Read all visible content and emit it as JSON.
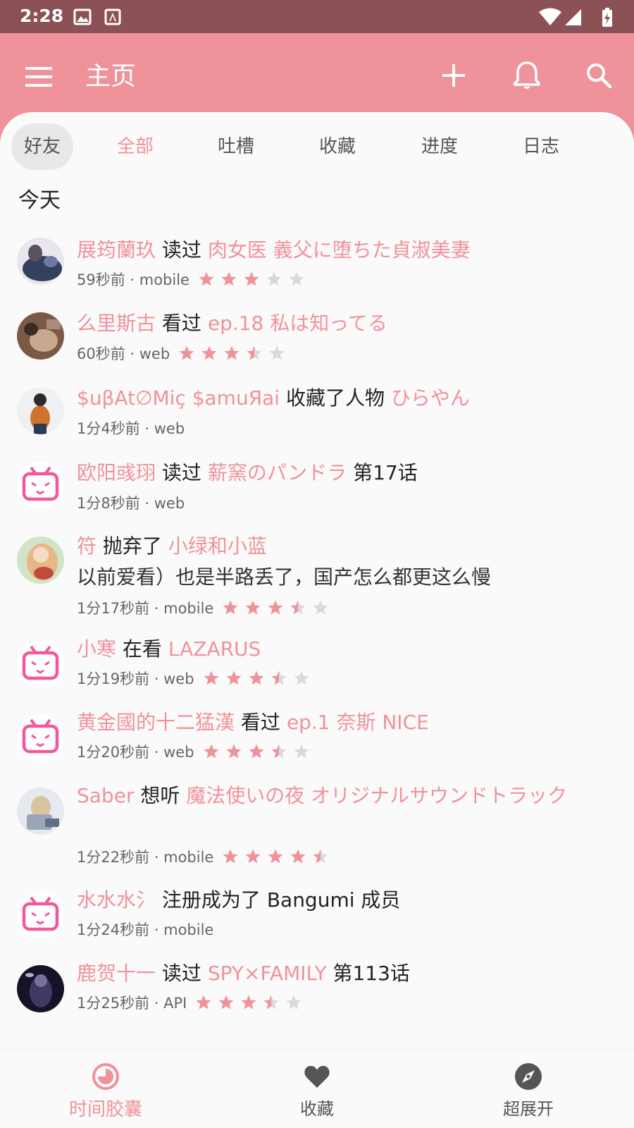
{
  "status_bar": {
    "time": "2:28"
  },
  "app_bar": {
    "title": "主页"
  },
  "tabs": [
    {
      "label": "好友"
    },
    {
      "label": "全部"
    },
    {
      "label": "吐槽"
    },
    {
      "label": "收藏"
    },
    {
      "label": "进度"
    },
    {
      "label": "日志"
    }
  ],
  "section": {
    "label": "今天"
  },
  "feed": [
    {
      "user": "展筠蘭玖",
      "action": "读过",
      "subject": "肉女医 義父に堕ちた貞淑美妻",
      "meta": "59秒前 · mobile",
      "rating": 3
    },
    {
      "user": "么里斯古",
      "action": "看过",
      "subject": "ep.18 私は知ってる",
      "meta": "60秒前 · web",
      "rating": 3.5
    },
    {
      "user": "$uβAt∅Miç $amuЯai",
      "action": "收藏了人物",
      "subject": "ひらやん",
      "meta": "1分4秒前 · web"
    },
    {
      "user": "欧阳彧珝",
      "action": "读过",
      "subject": "薪窯のパンドラ",
      "suffix": "第17话",
      "meta": "1分8秒前 · web"
    },
    {
      "user": "符",
      "action": "抛弃了",
      "subject": "小绿和小蓝",
      "comment": "以前爱看）也是半路丢了，国产怎么都更这么慢",
      "meta": "1分17秒前 · mobile",
      "rating": 3.5
    },
    {
      "user": "小寒",
      "action": "在看",
      "subject": "LAZARUS",
      "meta": "1分19秒前 · web",
      "rating": 3.5
    },
    {
      "user": "黄金國的十二猛漢",
      "action": "看过",
      "subject": "ep.1 奈斯 NICE",
      "meta": "1分20秒前 · web",
      "rating": 3.5
    },
    {
      "user": "Saber",
      "action": "想听",
      "subject": "魔法使いの夜 オリジナルサウンドトラック",
      "meta": "1分22秒前 · mobile",
      "rating": 4.5
    },
    {
      "user": "水水水氵",
      "action": "注册成为了 Bangumi 成员",
      "meta": "1分24秒前 · mobile"
    },
    {
      "user": "鹿贺十一",
      "action": "读过",
      "subject": "SPY×FAMILY",
      "suffix": "第113话",
      "meta": "1分25秒前 · API",
      "rating": 3.5
    }
  ],
  "bottom_nav": [
    {
      "label": "时间胶囊",
      "icon": "timeline-icon",
      "active": true
    },
    {
      "label": "收藏",
      "icon": "heart-icon",
      "active": false
    },
    {
      "label": "超展开",
      "icon": "compass-icon",
      "active": false
    }
  ],
  "colors": {
    "accent": "#f0929a",
    "status_bar": "#8c5157",
    "star_empty": "#d9d9d9"
  }
}
